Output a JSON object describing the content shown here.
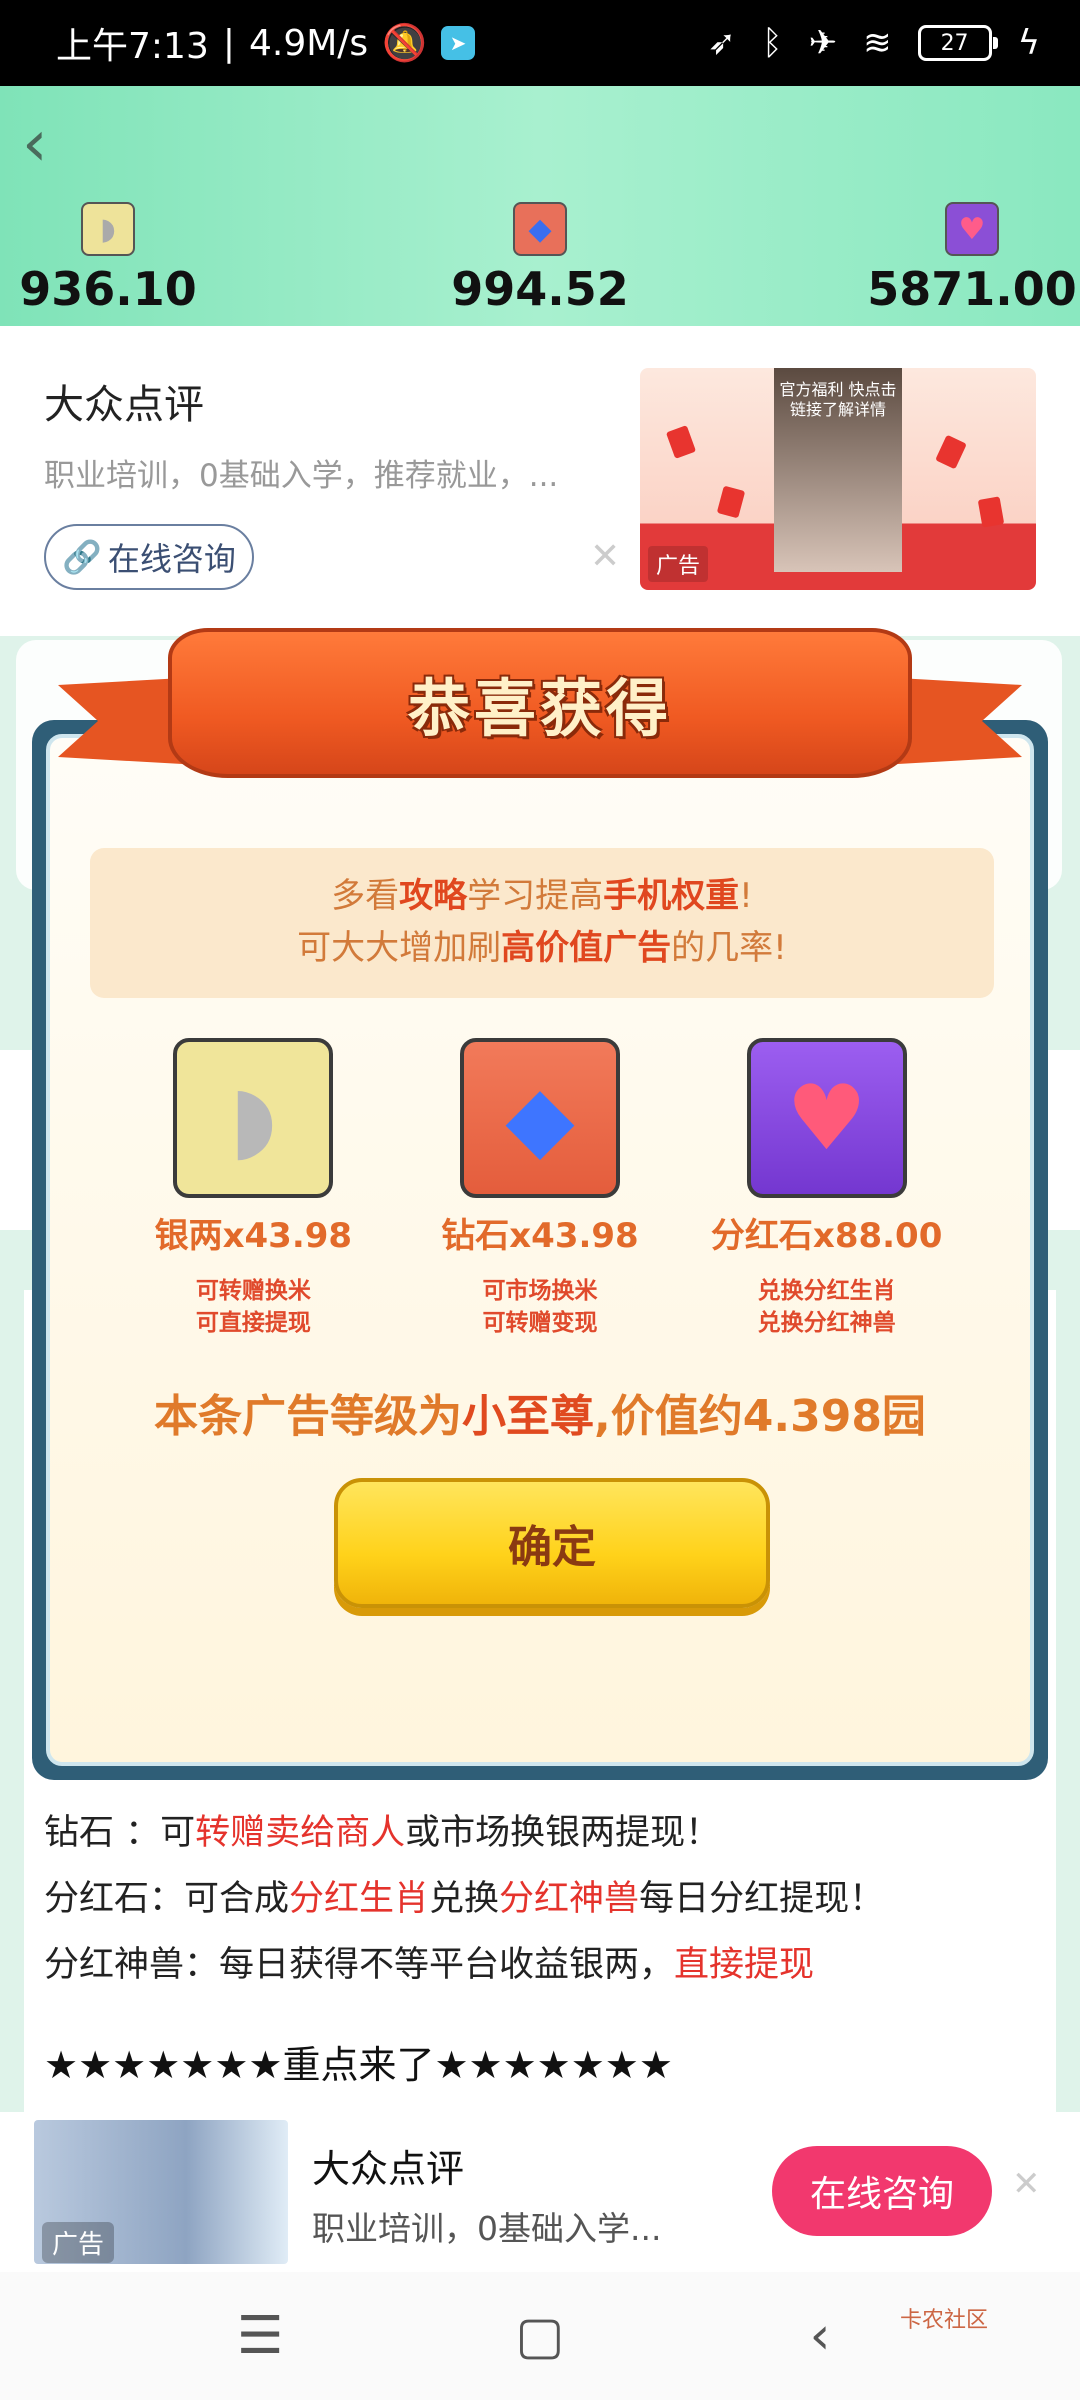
{
  "status_bar": {
    "time": "上午7:13",
    "speed": "4.9M/s",
    "battery": "27",
    "signal_icons": [
      "mute-icon",
      "location-icon",
      "bluetooth-icon",
      "airplane-icon",
      "wifi-icon"
    ]
  },
  "header": {
    "back_icon": "‹",
    "balances": [
      {
        "icon": "silver-ingot-icon",
        "value": "936.10"
      },
      {
        "icon": "diamond-icon",
        "value": "994.52"
      },
      {
        "icon": "gem-heart-icon",
        "value": "5871.00"
      }
    ]
  },
  "ad_top": {
    "title": "大众点评",
    "desc": "职业培训，0基础入学，推荐就业，...",
    "consult": "在线咨询",
    "video_text": "官方福利 快点击链接了解详情",
    "tag": "广告"
  },
  "modal": {
    "title": "恭喜获得",
    "tip_line1_pre": "多看",
    "tip_line1_hl1": "攻略",
    "tip_line1_mid": "学习提高",
    "tip_line1_hl2": "手机权重",
    "tip_line1_post": "!",
    "tip_line2_pre": "可大大增加刷",
    "tip_line2_hl1": "高价值",
    "tip_line2_hl2": "广告",
    "tip_line2_post": "的几率!",
    "rewards": [
      {
        "name": "银两x43.98",
        "note1": "可转赠换米",
        "note2": "可直接提现"
      },
      {
        "name": "钻石x43.98",
        "note1": "可市场换米",
        "note2": "可转赠变现"
      },
      {
        "name": "分红石x88.00",
        "note1": "兑换分红生肖",
        "note2": "兑换分红神兽"
      }
    ],
    "value_pre": "本条广告等级为",
    "value_level": "小至尊",
    "value_post": ",价值约4.398园",
    "ok_label": "确定"
  },
  "article": {
    "line1_a": "钻石 ：可",
    "line1_red": "转赠卖给商人",
    "line1_b": "或市场换银两提现！",
    "line2_a": "分红石：可合成",
    "line2_red1": "分红生肖",
    "line2_b": "兑换",
    "line2_red2": "分红神兽",
    "line2_c": "每日分红提现！",
    "line3_a": "分红神兽：每日获得不等平台收益银两，",
    "line3_red": "直接提现",
    "stars": "★★★★★★★重点来了★★★★★★★"
  },
  "ad_bottom": {
    "title": "大众点评",
    "desc": "职业培训，0基础入学...",
    "button": "在线咨询",
    "tag": "广告"
  },
  "navbar": {
    "menu": "☰",
    "home": "▢",
    "back": "‹"
  },
  "watermark": "卡农社区"
}
